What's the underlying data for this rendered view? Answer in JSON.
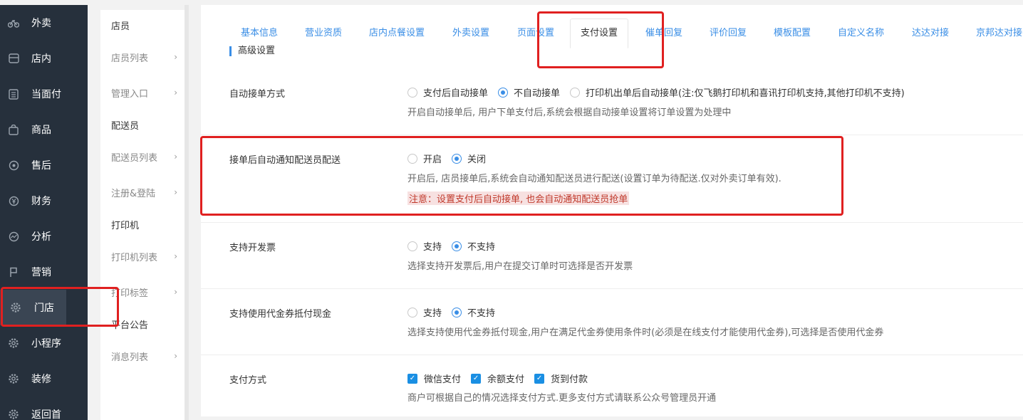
{
  "sidebar": {
    "items": [
      {
        "label": "外卖",
        "icon": "bike-icon"
      },
      {
        "label": "店内",
        "icon": "store-icon"
      },
      {
        "label": "当面付",
        "icon": "receipt-icon"
      },
      {
        "label": "商品",
        "icon": "bag-icon"
      },
      {
        "label": "售后",
        "icon": "service-icon"
      },
      {
        "label": "财务",
        "icon": "yen-icon"
      },
      {
        "label": "分析",
        "icon": "chart-icon"
      },
      {
        "label": "营销",
        "icon": "flag-icon"
      },
      {
        "label": "门店",
        "icon": "gear-icon"
      },
      {
        "label": "小程序",
        "icon": "gear-icon"
      },
      {
        "label": "装修",
        "icon": "gear-icon"
      },
      {
        "label": "返回首",
        "icon": "gear-icon"
      }
    ]
  },
  "subnav": {
    "items": [
      {
        "label": "店员"
      },
      {
        "label": "店员列表"
      },
      {
        "label": "管理入口"
      },
      {
        "label": "配送员"
      },
      {
        "label": "配送员列表"
      },
      {
        "label": "注册&登陆"
      },
      {
        "label": "打印机"
      },
      {
        "label": "打印机列表"
      },
      {
        "label": "打印标签"
      },
      {
        "label": "平台公告"
      },
      {
        "label": "消息列表"
      }
    ]
  },
  "tabs": [
    "基本信息",
    "营业资质",
    "店内点餐设置",
    "外卖设置",
    "页面设置",
    "支付设置",
    "催单回复",
    "评价回复",
    "模板配置",
    "自定义名称",
    "达达对接",
    "京邦达对接"
  ],
  "section_title": "高级设置",
  "settings": {
    "auto_accept": {
      "label": "自动接单方式",
      "options": [
        "支付后自动接单",
        "不自动接单",
        "打印机出单后自动接单(注:仅飞鹅打印机和喜讯打印机支持,其他打印机不支持)"
      ],
      "hint": "开启自动接单后, 用户下单支付后,系统会根据自动接单设置将订单设置为处理中"
    },
    "notify_courier": {
      "label": "接单后自动通知配送员配送",
      "options": [
        "开启",
        "关闭"
      ],
      "hint": "开启后, 店员接单后,系统会自动通知配送员进行配送(设置订单为待配送.仅对外卖订单有效).",
      "warn": "注意：设置支付后自动接单, 也会自动通知配送员抢单"
    },
    "invoice": {
      "label": "支持开发票",
      "options": [
        "支持",
        "不支持"
      ],
      "hint": "选择支持开发票后,用户在提交订单时可选择是否开发票"
    },
    "voucher": {
      "label": "支持使用代金券抵付现金",
      "options": [
        "支持",
        "不支持"
      ],
      "hint": "选择支持使用代金券抵付现金,用户在满足代金券使用条件时(必须是在线支付才能使用代金券),可选择是否使用代金券"
    },
    "payment": {
      "label": "支付方式",
      "options": [
        "微信支付",
        "余额支付",
        "货到付款"
      ],
      "hint": "商户可根据自己的情况选择支付方式.更多支付方式请联系公众号管理员开通"
    }
  }
}
